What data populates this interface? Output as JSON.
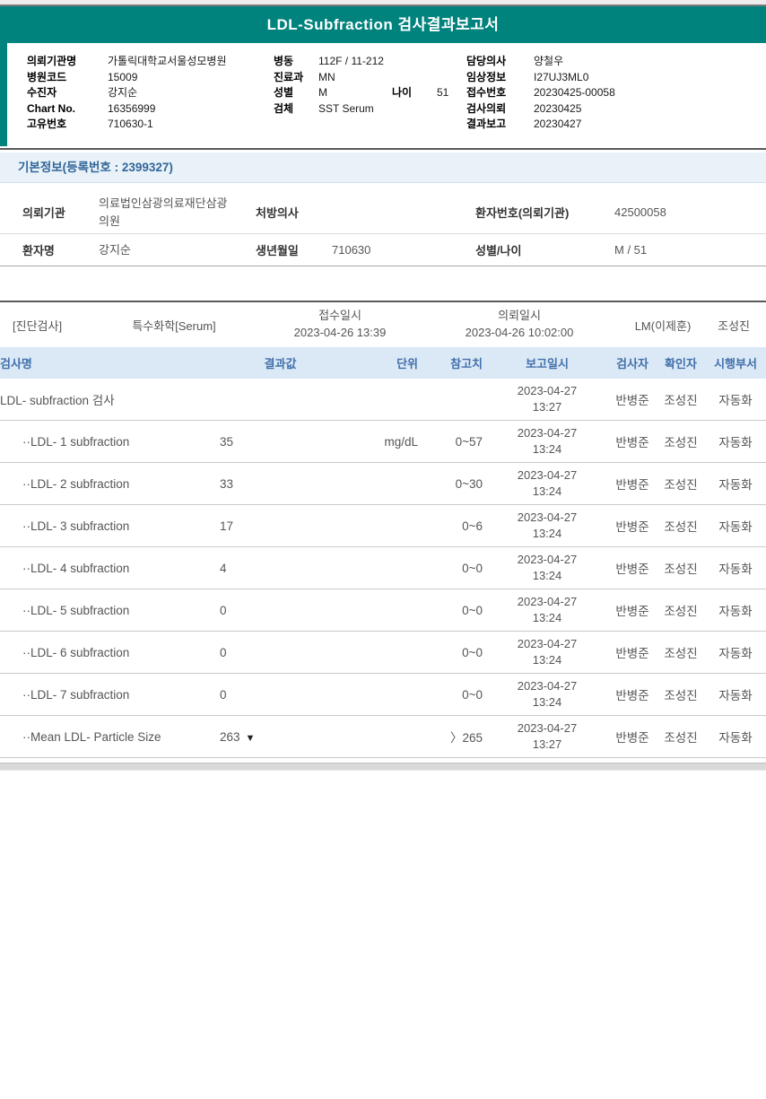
{
  "title": "LDL-Subfraction 검사결과보고서",
  "accent_color": "#00827d",
  "header_info": {
    "col1": [
      {
        "label": "의뢰기관명",
        "value": "가톨릭대학교서울성모병원"
      },
      {
        "label": "병원코드",
        "value": "15009"
      },
      {
        "label": "수진자",
        "value": "강지순"
      },
      {
        "label": "Chart No.",
        "value": "16356999"
      },
      {
        "label": "고유번호",
        "value": "710630-1"
      }
    ],
    "col2": [
      {
        "label": "병동",
        "value": "112F / 11-212",
        "label2": "",
        "value2": ""
      },
      {
        "label": "진료과",
        "value": "MN",
        "label2": "",
        "value2": ""
      },
      {
        "label": "성별",
        "value": "M",
        "label2": "나이",
        "value2": "51"
      },
      {
        "label": "검체",
        "value": "SST Serum",
        "label2": "",
        "value2": ""
      }
    ],
    "col3": [
      {
        "label": "담당의사",
        "value": "양철우"
      },
      {
        "label": "임상정보",
        "value": "I27UJ3ML0"
      },
      {
        "label": "접수번호",
        "value": "20230425-00058"
      },
      {
        "label": "검사의뢰",
        "value": "20230425"
      },
      {
        "label": "결과보고",
        "value": "20230427"
      }
    ]
  },
  "basic_info": {
    "section_title": "기본정보(등록번호 : 2399327)",
    "rows": [
      {
        "label1": "의뢰기관",
        "value1": "의료법인삼광의료재단삼광의원",
        "label2": "처방의사",
        "value2": "",
        "label3": "환자번호(의뢰기관)",
        "value3": "42500058"
      },
      {
        "label1": "환자명",
        "value1": "강지순",
        "label2": "생년월일",
        "value2": "710630",
        "label3": "성별/나이",
        "value3": "M / 51"
      }
    ]
  },
  "results": {
    "meta": {
      "dept": "[진단검사]",
      "category": "특수화학[Serum]",
      "receipt_label": "접수일시",
      "receipt_value": "2023-04-26 13:39",
      "request_label": "의뢰일시",
      "request_value": "2023-04-26 10:02:00",
      "lab": "LM(이제훈)",
      "approver": "조성진"
    },
    "header": {
      "name": "검사명",
      "result": "결과값",
      "unit": "단위",
      "ref": "참고치",
      "reported": "보고일시",
      "tester": "검사자",
      "confirmer": "확인자",
      "dept": "시행부서"
    },
    "rows": [
      {
        "level": "0",
        "name": "LDL- subfraction 검사",
        "result": "",
        "marker": "",
        "unit": "",
        "ref": "",
        "rep_date": "2023-04-27",
        "rep_time": "13:27",
        "tester": "반병준",
        "confirmer": "조성진",
        "dept": "자동화"
      },
      {
        "level": "1",
        "name": "··LDL- 1 subfraction",
        "result": "35",
        "marker": "",
        "unit": "mg/dL",
        "ref": "0~57",
        "rep_date": "2023-04-27",
        "rep_time": "13:24",
        "tester": "반병준",
        "confirmer": "조성진",
        "dept": "자동화"
      },
      {
        "level": "1",
        "name": "··LDL- 2 subfraction",
        "result": "33",
        "marker": "",
        "unit": "",
        "ref": "0~30",
        "rep_date": "2023-04-27",
        "rep_time": "13:24",
        "tester": "반병준",
        "confirmer": "조성진",
        "dept": "자동화"
      },
      {
        "level": "1",
        "name": "··LDL- 3 subfraction",
        "result": "17",
        "marker": "",
        "unit": "",
        "ref": "0~6",
        "rep_date": "2023-04-27",
        "rep_time": "13:24",
        "tester": "반병준",
        "confirmer": "조성진",
        "dept": "자동화"
      },
      {
        "level": "1",
        "name": "··LDL- 4 subfraction",
        "result": "4",
        "marker": "",
        "unit": "",
        "ref": "0~0",
        "rep_date": "2023-04-27",
        "rep_time": "13:24",
        "tester": "반병준",
        "confirmer": "조성진",
        "dept": "자동화"
      },
      {
        "level": "1",
        "name": "··LDL- 5 subfraction",
        "result": "0",
        "marker": "",
        "unit": "",
        "ref": "0~0",
        "rep_date": "2023-04-27",
        "rep_time": "13:24",
        "tester": "반병준",
        "confirmer": "조성진",
        "dept": "자동화"
      },
      {
        "level": "1",
        "name": "··LDL- 6 subfraction",
        "result": "0",
        "marker": "",
        "unit": "",
        "ref": "0~0",
        "rep_date": "2023-04-27",
        "rep_time": "13:24",
        "tester": "반병준",
        "confirmer": "조성진",
        "dept": "자동화"
      },
      {
        "level": "1",
        "name": "··LDL- 7 subfraction",
        "result": "0",
        "marker": "",
        "unit": "",
        "ref": "0~0",
        "rep_date": "2023-04-27",
        "rep_time": "13:24",
        "tester": "반병준",
        "confirmer": "조성진",
        "dept": "자동화"
      },
      {
        "level": "1",
        "name": "··Mean LDL- Particle Size",
        "result": "263",
        "marker": "▼",
        "unit": "",
        "ref": "〉265",
        "rep_date": "2023-04-27",
        "rep_time": "13:27",
        "tester": "반병준",
        "confirmer": "조성진",
        "dept": "자동화"
      }
    ]
  }
}
